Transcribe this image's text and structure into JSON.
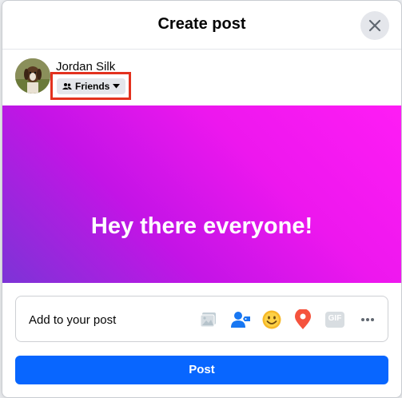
{
  "dialog": {
    "title": "Create post"
  },
  "author": {
    "name": "Jordan Silk",
    "privacy_label": "Friends"
  },
  "post": {
    "text": "Hey there everyone!"
  },
  "add_to_post": {
    "label": "Add to your post",
    "icons": [
      "photo-video-icon",
      "tag-people-icon",
      "feeling-activity-icon",
      "check-in-icon",
      "gif-icon",
      "more-icon"
    ],
    "gif_text": "GIF"
  },
  "actions": {
    "post_label": "Post"
  },
  "colors": {
    "accent": "#0866ff",
    "highlight": "#e3321f",
    "banner_start": "#7c34d6",
    "banner_end": "#ff1cf5"
  }
}
